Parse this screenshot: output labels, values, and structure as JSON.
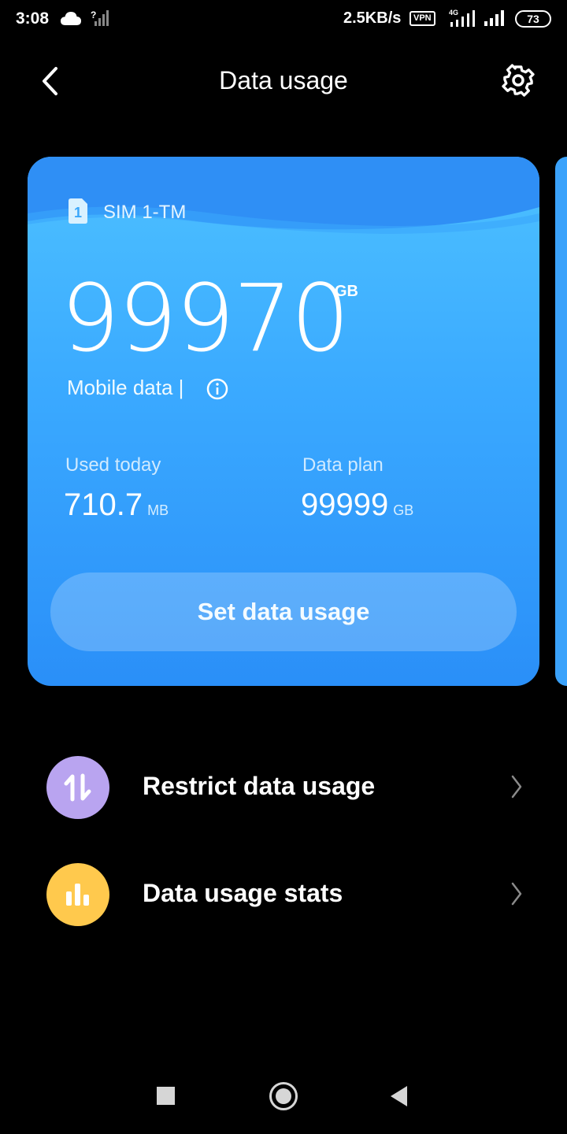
{
  "status_bar": {
    "time": "3:08",
    "net_speed": "2.5KB/s",
    "vpn": "VPN",
    "network_type": "4G",
    "battery": "73"
  },
  "header": {
    "title": "Data usage"
  },
  "card": {
    "sim_number": "1",
    "sim_name": "SIM 1-TM",
    "remaining_value": "99970",
    "remaining_unit": "GB",
    "mobile_label": "Mobile data |",
    "used_today_label": "Used today",
    "used_today_value": "710.7",
    "used_today_unit": "MB",
    "data_plan_label": "Data plan",
    "data_plan_value": "99999",
    "data_plan_unit": "GB",
    "set_button": "Set data usage",
    "colors": {
      "card_top": "#4dc1ff",
      "card_bottom": "#2a8ff8"
    }
  },
  "menu": [
    {
      "label": "Restrict data usage",
      "icon": "arrows-up-down-icon",
      "color": "#b9a4f0"
    },
    {
      "label": "Data usage stats",
      "icon": "bar-chart-icon",
      "color": "#ffc94d"
    }
  ]
}
